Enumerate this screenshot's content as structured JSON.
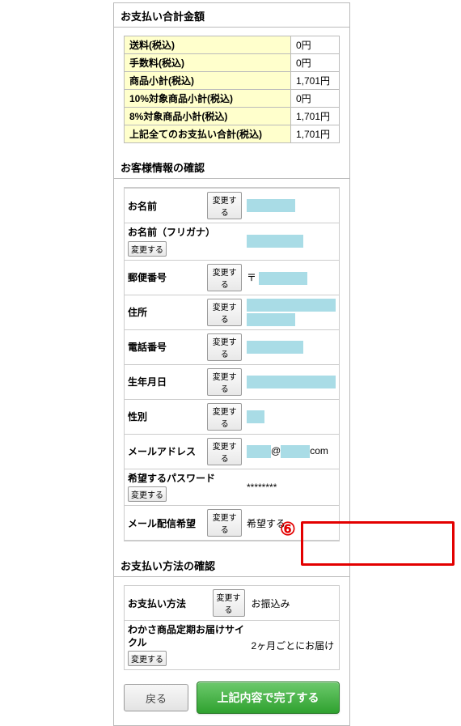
{
  "summary": {
    "heading": "お支払い合計金額",
    "rows": [
      {
        "label": "送料(税込)",
        "value": "0円"
      },
      {
        "label": "手数料(税込)",
        "value": "0円"
      },
      {
        "label": "商品小計(税込)",
        "value": "1,701円"
      },
      {
        "label": "10%対象商品小計(税込)",
        "value": "0円"
      },
      {
        "label": "8%対象商品小計(税込)",
        "value": "1,701円"
      },
      {
        "label": "上記全てのお支払い合計(税込)",
        "value": "1,701円"
      }
    ]
  },
  "customer": {
    "heading": "お客様情報の確認",
    "change_label": "変更する",
    "labels": {
      "name": "お名前",
      "name_kana": "お名前（フリガナ）",
      "postal": "郵便番号",
      "address": "住所",
      "phone": "電話番号",
      "birth": "生年月日",
      "gender": "性別",
      "email": "メールアドレス",
      "password": "希望するパスワード",
      "mail_opt": "メール配信希望"
    },
    "values": {
      "postal_prefix": "〒",
      "email_at": "@",
      "email_domain_suffix": "com",
      "password_mask": "********",
      "mail_opt": "希望する"
    }
  },
  "payment": {
    "heading": "お支払い方法の確認",
    "change_label": "変更する",
    "rows": {
      "method_label": "お支払い方法",
      "method_value": "お振込み",
      "cycle_label": "わかさ商品定期お届けサイクル",
      "cycle_value": "2ヶ月ごとにお届け"
    }
  },
  "buttons": {
    "back": "戻る",
    "submit": "上記内容で完了する"
  },
  "callout": {
    "number": "⑥"
  }
}
